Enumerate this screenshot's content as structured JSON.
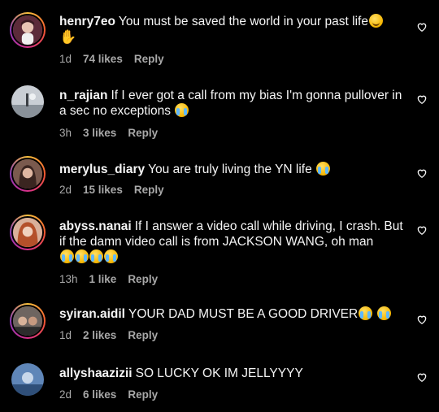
{
  "comments": [
    {
      "username": "henry7eo",
      "text": "You must be saved the world in your past life",
      "emoji": "🤣🤘",
      "time": "1d",
      "likes": "74 likes",
      "reply": "Reply"
    },
    {
      "username": "n_rajian",
      "text": "If I ever got a call from my bias I'm gonna pullover in a sec no exceptions",
      "emoji": "😭",
      "time": "3h",
      "likes": "3 likes",
      "reply": "Reply"
    },
    {
      "username": "merylus_diary",
      "text": "You are truly living the YN life",
      "emoji": "😂",
      "time": "2d",
      "likes": "15 likes",
      "reply": "Reply"
    },
    {
      "username": "abyss.nanai",
      "text": "If I answer a video call while driving, I crash. But if the damn video call is from JACKSON WANG, oh man",
      "emoji": "😂😭😭😭",
      "time": "13h",
      "likes": "1 like",
      "reply": "Reply"
    },
    {
      "username": "syiran.aidil",
      "text": "YOUR DAD MUST BE A GOOD DRIVER",
      "emoji": "😭😭",
      "time": "1d",
      "likes": "2 likes",
      "reply": "Reply"
    },
    {
      "username": "allyshaazizii",
      "text": "SO LUCKY OK IM JELLYYYY",
      "emoji": "",
      "time": "2d",
      "likes": "6 likes",
      "reply": "Reply"
    }
  ],
  "icons": {
    "like": "heart-outline-icon"
  },
  "colors": {
    "background": "#000000",
    "text": "#f5f5f5",
    "meta": "#a8a8a8"
  }
}
